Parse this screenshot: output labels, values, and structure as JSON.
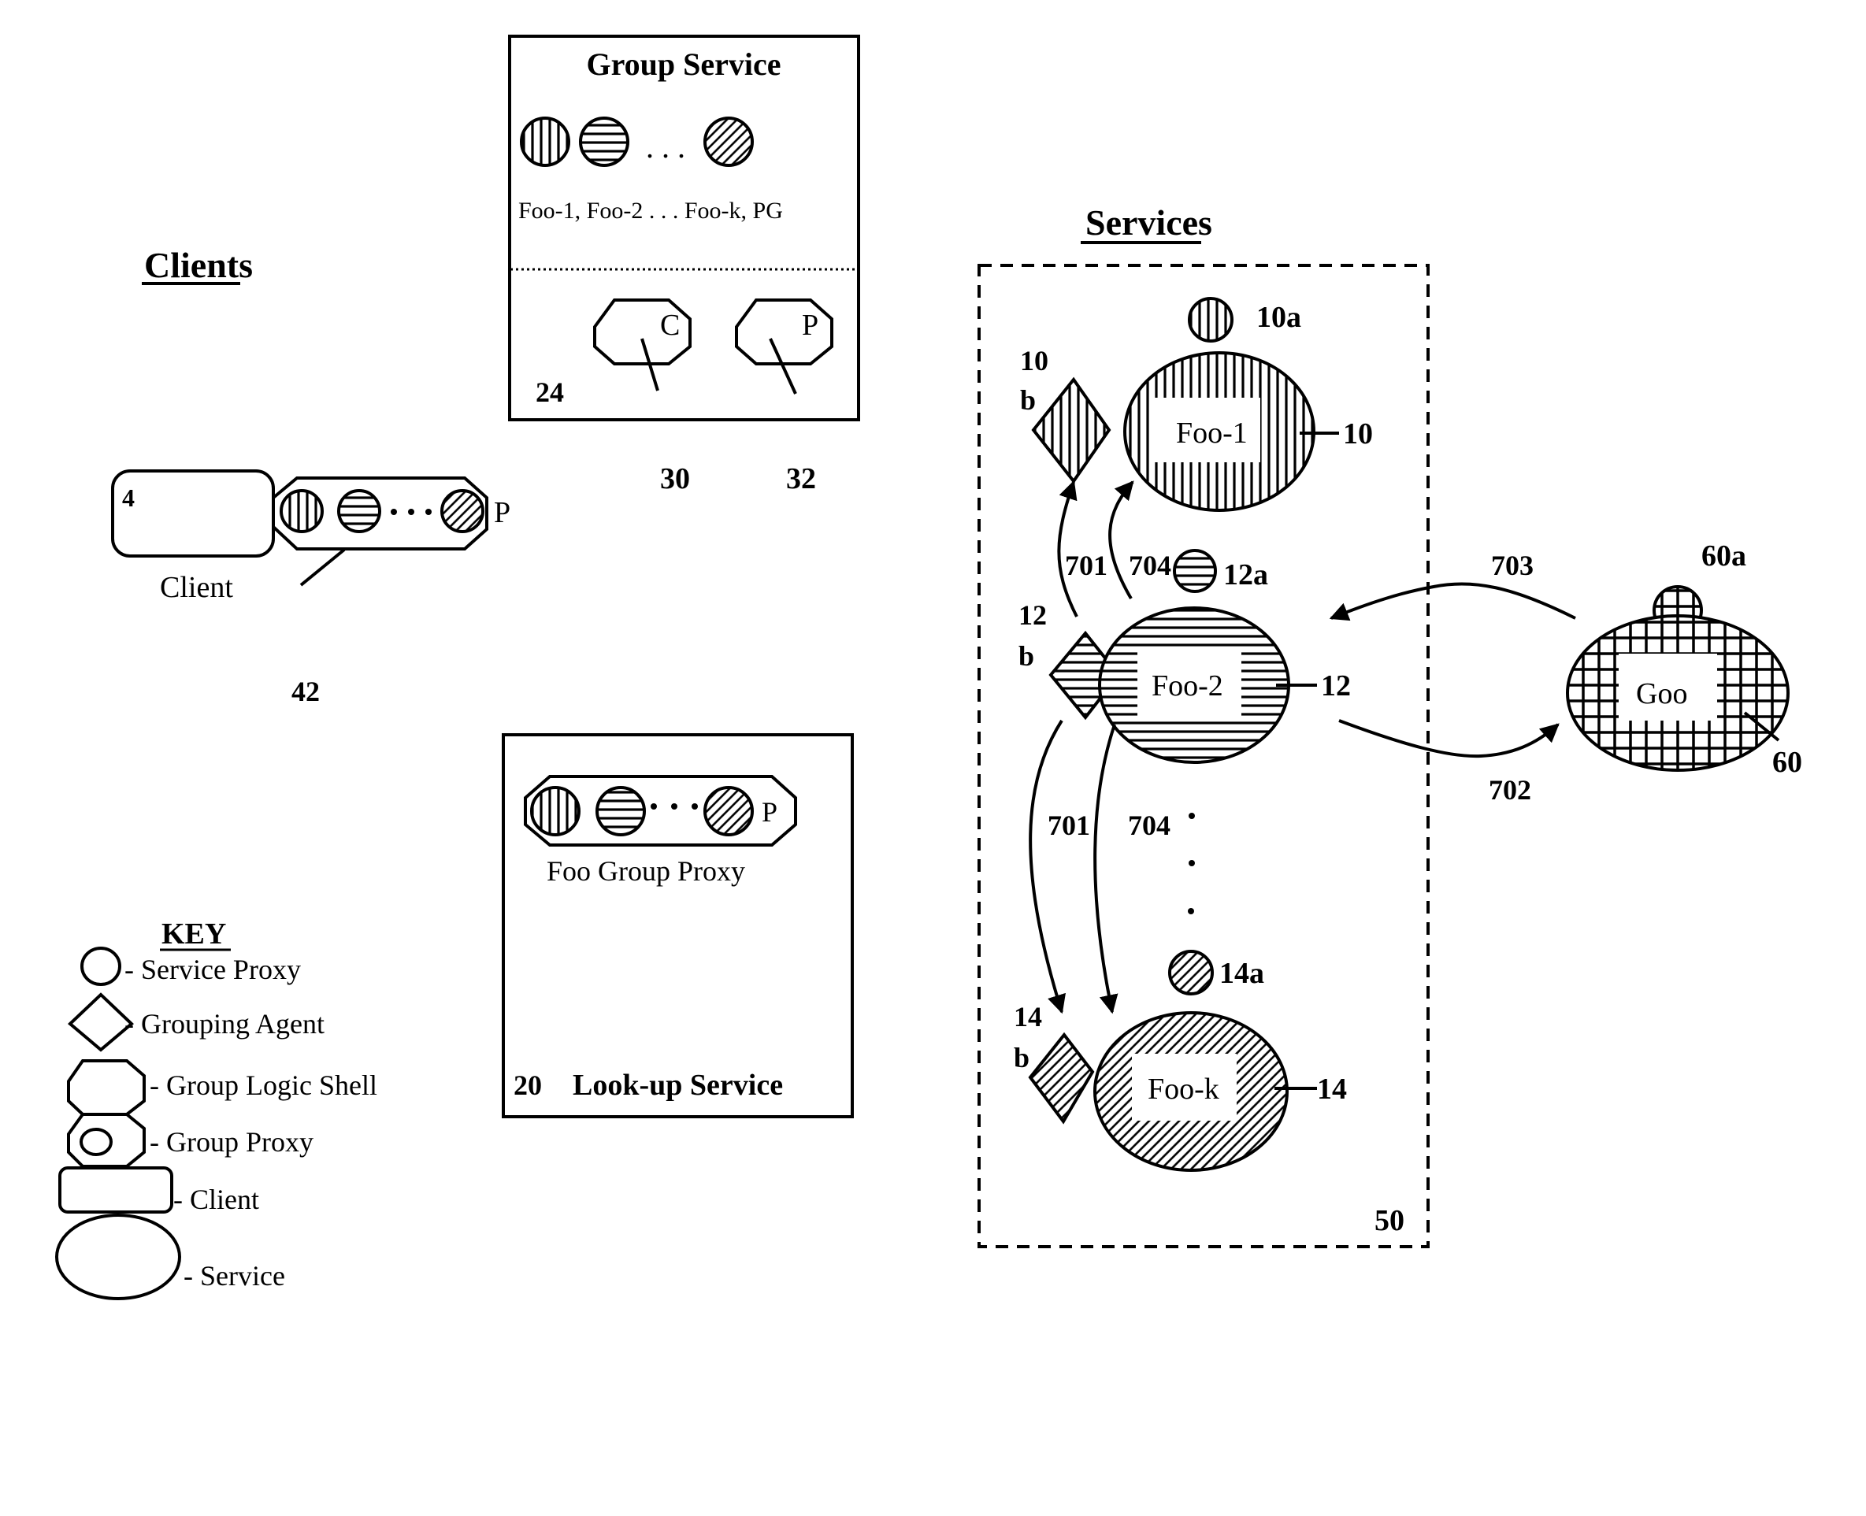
{
  "clients": {
    "title": "Clients",
    "client": {
      "ref": "4",
      "label": "Client"
    },
    "group_proxy": {
      "ref": "42",
      "label": "P"
    }
  },
  "group_service": {
    "title": "Group Service",
    "proxies_caption": "Foo-1, Foo-2 . . . Foo-k, PG",
    "ellipsis": ". . .",
    "ref": "24",
    "shells": [
      {
        "letter": "C",
        "ref": "30"
      },
      {
        "letter": "P",
        "ref": "32"
      }
    ]
  },
  "lookup_service": {
    "ref": "20",
    "title": "Look-up Service",
    "proxy_label": "P",
    "caption": "Foo Group Proxy"
  },
  "services": {
    "title": "Services",
    "group_ref": "50",
    "nodes": [
      {
        "name": "Foo-1",
        "ref": "10",
        "proxy_ref": "10a",
        "agent_ref_top": "10",
        "agent_ref_bottom": "b",
        "pattern": "vertical"
      },
      {
        "name": "Foo-2",
        "ref": "12",
        "proxy_ref": "12a",
        "agent_ref_top": "12",
        "agent_ref_bottom": "b",
        "pattern": "horizontal"
      },
      {
        "name": "Foo-k",
        "ref": "14",
        "proxy_ref": "14a",
        "agent_ref_top": "14",
        "agent_ref_bottom": "b",
        "pattern": "diagonal"
      }
    ],
    "external": {
      "name": "Goo",
      "ref": "60",
      "proxy_ref": "60a",
      "pattern": "grid"
    },
    "arrows": [
      {
        "id": "701",
        "from": "12b",
        "to": "10b"
      },
      {
        "id": "704",
        "from": "Foo-2",
        "to": "Foo-1"
      },
      {
        "id": "701",
        "from": "12b",
        "to": "14b"
      },
      {
        "id": "704",
        "from": "Foo-2",
        "to": "Foo-k"
      },
      {
        "id": "702",
        "from": "Foo-2",
        "to": "Goo"
      },
      {
        "id": "703",
        "from": "Goo",
        "to": "Foo-2"
      }
    ]
  },
  "key": {
    "title": "KEY",
    "items": [
      {
        "shape": "circle",
        "label": "- Service Proxy"
      },
      {
        "shape": "diamond",
        "label": "- Grouping Agent"
      },
      {
        "shape": "octagon",
        "label": "- Group Logic Shell"
      },
      {
        "shape": "octagon-circle",
        "label": "- Group Proxy"
      },
      {
        "shape": "rounded-rect",
        "label": "- Client"
      },
      {
        "shape": "ellipse",
        "label": "- Service"
      }
    ]
  }
}
